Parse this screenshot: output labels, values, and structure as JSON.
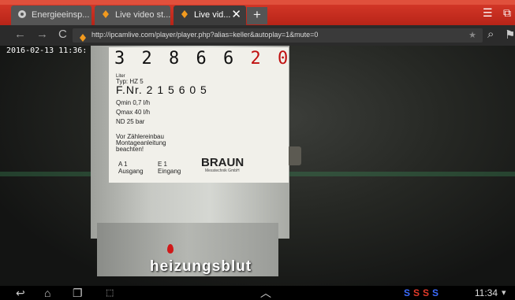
{
  "browser": {
    "tabs": [
      {
        "label": "Energieeinsp..."
      },
      {
        "label": "Live video st..."
      },
      {
        "label": "Live vid..."
      }
    ],
    "new_tab_label": "+",
    "url": "http://ipcamlive.com/player/player.php?alias=keller&autoplay=1&mute=0"
  },
  "video": {
    "timestamp": "2016-02-13 11:36:",
    "meter_digits_black": "3 2 8 6 6",
    "meter_digits_red": "2 0",
    "label_small": "Liter",
    "typ": "Typ: HZ 5",
    "fnr": "F.Nr. 2 1 5 6 0 5",
    "qmin": "Qmin 0,7 l/h",
    "qmax": "Qmax 40 l/h",
    "nd": "ND 25 bar",
    "install_note": "Vor Zählereinbau\nMontageanleitung\nbeachten!",
    "a1": "A 1\nAusgang",
    "e1": "E 1\nEingang",
    "brand": "BRAUN",
    "brand_sub": "Messtechnik GmbH",
    "watermark": "heizungsblut"
  },
  "statusbar": {
    "clock": "11:34",
    "notif_colors": [
      "#3b6cff",
      "#e23b2a",
      "#e23b2a",
      "#3b6cff"
    ]
  }
}
